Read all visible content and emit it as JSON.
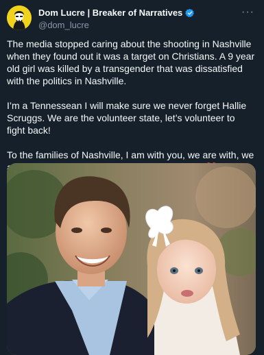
{
  "author": {
    "display_name": "Dom Lucre | Breaker of Narratives",
    "handle": "@dom_lucre",
    "verified": true
  },
  "more_label": "···",
  "tweet": {
    "paragraph_1": "The media stopped caring about the shooting in Nashville when they found out it was a target on Christians. A 9 year old girl was killed by a transgender that was dissatisfied with the politics in Nashville.",
    "paragraph_2": "I’m a Tennessean I will make sure we never forget Hallie Scruggs. We are the volunteer state, let’s volunteer to fight back!",
    "paragraph_3": "To the families of Nashville, I am with you, we are with, we are only a request away and we will volunteer.",
    "heart_emoji": "❤️"
  },
  "colors": {
    "background": "#15202b",
    "text": "#f7f9f9",
    "secondary": "#8b98a5",
    "verified": "#1d9bf0",
    "avatar_bg": "#f2d31b"
  }
}
